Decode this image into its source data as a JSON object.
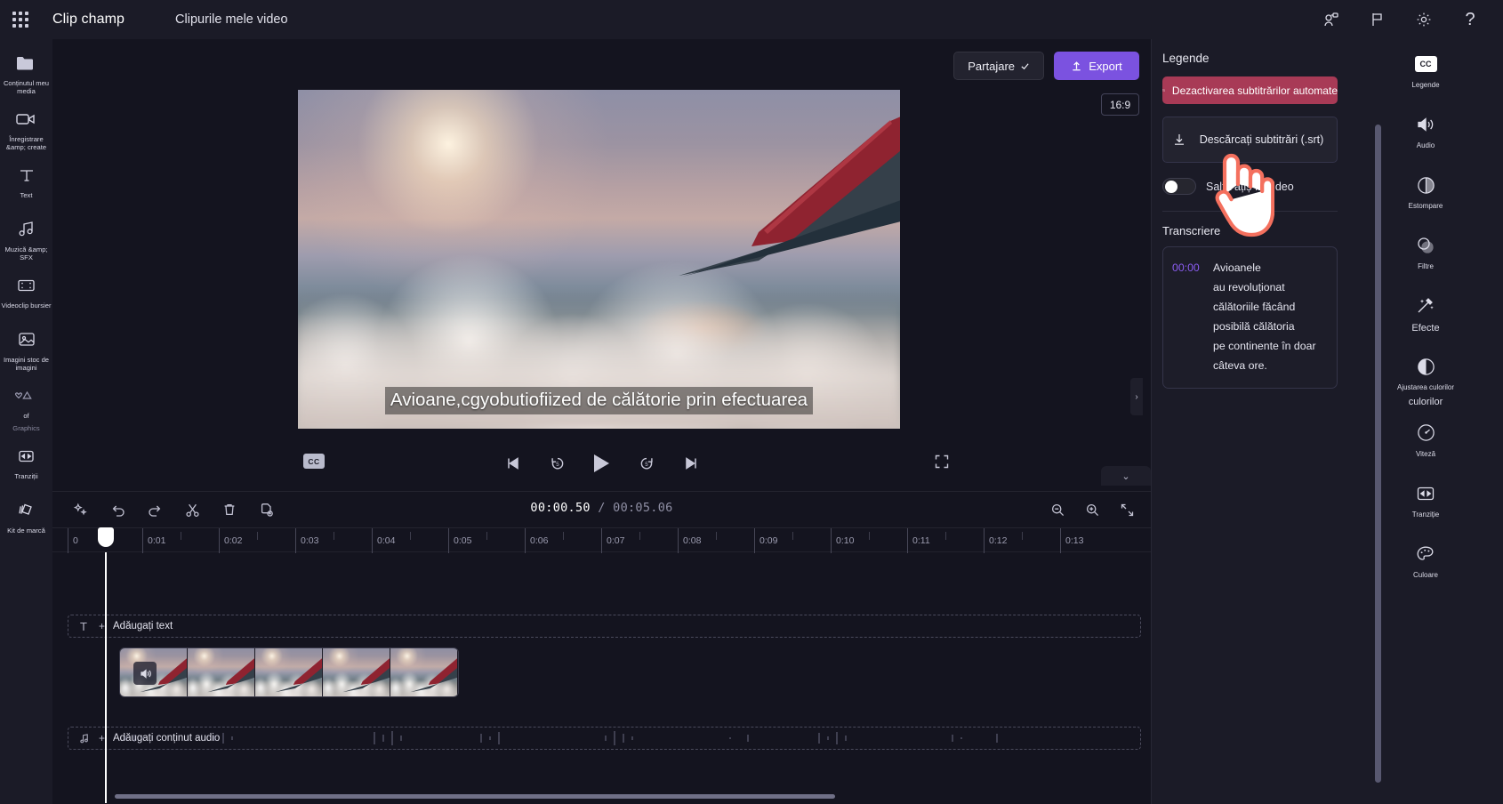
{
  "topbar": {
    "waffle_icon": "app-launcher-icon",
    "brand": "Clip champ",
    "project_name": "Clipurile mele video",
    "icons": [
      {
        "name": "share-person-icon",
        "glyph": "share"
      },
      {
        "name": "flag-feedback-icon",
        "glyph": "flag"
      },
      {
        "name": "settings-gear-icon",
        "glyph": "gear"
      },
      {
        "name": "help-question-icon",
        "glyph": "?"
      }
    ]
  },
  "left_rail": {
    "items": [
      {
        "label": "Conținutul meu media",
        "icon": "folder-icon",
        "dim": false
      },
      {
        "label": "Înregistrare &amp; create",
        "icon": "camera-icon",
        "dim": false
      },
      {
        "label": "Text",
        "icon": "text-icon",
        "dim": false
      },
      {
        "label": "Muzică &amp; SFX",
        "icon": "music-note-icon",
        "dim": false
      },
      {
        "label": "Videoclip bursier",
        "icon": "film-strip-icon",
        "dim": false
      },
      {
        "label": "Imagini stoc de imagini",
        "icon": "image-icon",
        "dim": false
      },
      {
        "label": "of",
        "sub_label": "Graphics",
        "icon": "shapes-icon",
        "dim": true
      },
      {
        "label": "Tranziții",
        "icon": "transition-icon",
        "dim": false
      },
      {
        "label": "Kit de marcă",
        "icon": "brand-kit-icon",
        "dim": false
      }
    ],
    "expand_chevron": "›"
  },
  "stage": {
    "share_label": "Partajare",
    "share_icon": "share-icon",
    "export_label": "Export",
    "export_icon": "upload-icon",
    "export_color": "#7b52e0",
    "aspect_ratio": "16:9",
    "subtitle_overlay": "Avioane,cgyobutiofiized de călătorie prin efectuarea",
    "panel_arrow": "›",
    "collapse_chevron": "⌄"
  },
  "player": {
    "cc_label": "CC",
    "controls": [
      {
        "name": "skip-to-start-button",
        "glyph": "prev"
      },
      {
        "name": "rewind-5s-button",
        "glyph": "back5"
      },
      {
        "name": "play-button",
        "glyph": "play"
      },
      {
        "name": "forward-5s-button",
        "glyph": "fwd5"
      },
      {
        "name": "skip-to-end-button",
        "glyph": "next"
      }
    ],
    "fullscreen_icon": "fullscreen-icon"
  },
  "timeline": {
    "tools": [
      {
        "name": "magic-tools-button",
        "glyph": "sparkle"
      },
      {
        "name": "undo-button",
        "glyph": "undo"
      },
      {
        "name": "redo-button",
        "glyph": "redo"
      },
      {
        "name": "split-button",
        "glyph": "scissors"
      },
      {
        "name": "delete-button",
        "glyph": "trash"
      },
      {
        "name": "duplicate-button",
        "glyph": "duplicate"
      }
    ],
    "current_time": "00:00.50",
    "time_separator": " / ",
    "total_time": "00:05.06",
    "zoom_tools": [
      {
        "name": "zoom-out-button",
        "glyph": "zoom-out"
      },
      {
        "name": "zoom-in-button",
        "glyph": "zoom-in"
      },
      {
        "name": "fit-timeline-button",
        "glyph": "fit"
      }
    ],
    "ruler_ticks": [
      "0",
      "0:01",
      "0:02",
      "0:03",
      "0:04",
      "0:05",
      "0:06",
      "0:07",
      "0:08",
      "0:09",
      "0:10",
      "0:11",
      "0:12",
      "0:13"
    ],
    "text_track_label": "Adăugați text",
    "text_track_icon": "text-track-icon",
    "audio_track_label": "Adăugați conținut audio",
    "audio_track_icon": "music-track-icon",
    "add_glyph": "+",
    "video_clip_audio_icon": "speaker-icon"
  },
  "right_panel": {
    "title": "Legende",
    "disable_captions_label": "Dezactivarea subtitrărilor automate",
    "disable_captions_icon": "captions-off-icon",
    "disable_captions_color": "#a83a56",
    "download_srt_label": "Descărcați subtitrări (.srt)",
    "download_srt_icon": "download-icon",
    "toggle_label": "Saltă ațiș în video",
    "toggle_state": "off",
    "transcription_title": "Transcriere",
    "transcript": [
      {
        "time": "00:00",
        "text": "Avioanele"
      },
      {
        "time": "",
        "text": "au revoluționat"
      },
      {
        "time": "",
        "text": "călătoriile făcând"
      },
      {
        "time": "",
        "text": "posibilă călătoria"
      },
      {
        "time": "",
        "text": "pe continente în doar"
      },
      {
        "time": "",
        "text": "câteva ore."
      }
    ],
    "transcript_time_color": "#8a5cf0"
  },
  "right_rail": {
    "items": [
      {
        "label": "Legende",
        "icon": "cc-icon",
        "big": false
      },
      {
        "label": "Audio",
        "icon": "speaker-icon",
        "big": false
      },
      {
        "label": "Estompare",
        "icon": "fade-icon",
        "big": false
      },
      {
        "label": "Filtre",
        "icon": "filters-icon",
        "big": false
      },
      {
        "label": "Efecte",
        "icon": "effects-wand-icon",
        "big": true
      },
      {
        "label": "Ajustarea culorilor",
        "sub_label": "culorilor",
        "icon": "color-adjust-icon",
        "big": false
      },
      {
        "label": "Viteză",
        "icon": "speed-gauge-icon",
        "big": false
      },
      {
        "label": "Tranziție",
        "icon": "transition-icon",
        "big": false
      },
      {
        "label": "Culoare",
        "icon": "palette-icon",
        "big": false
      }
    ]
  }
}
